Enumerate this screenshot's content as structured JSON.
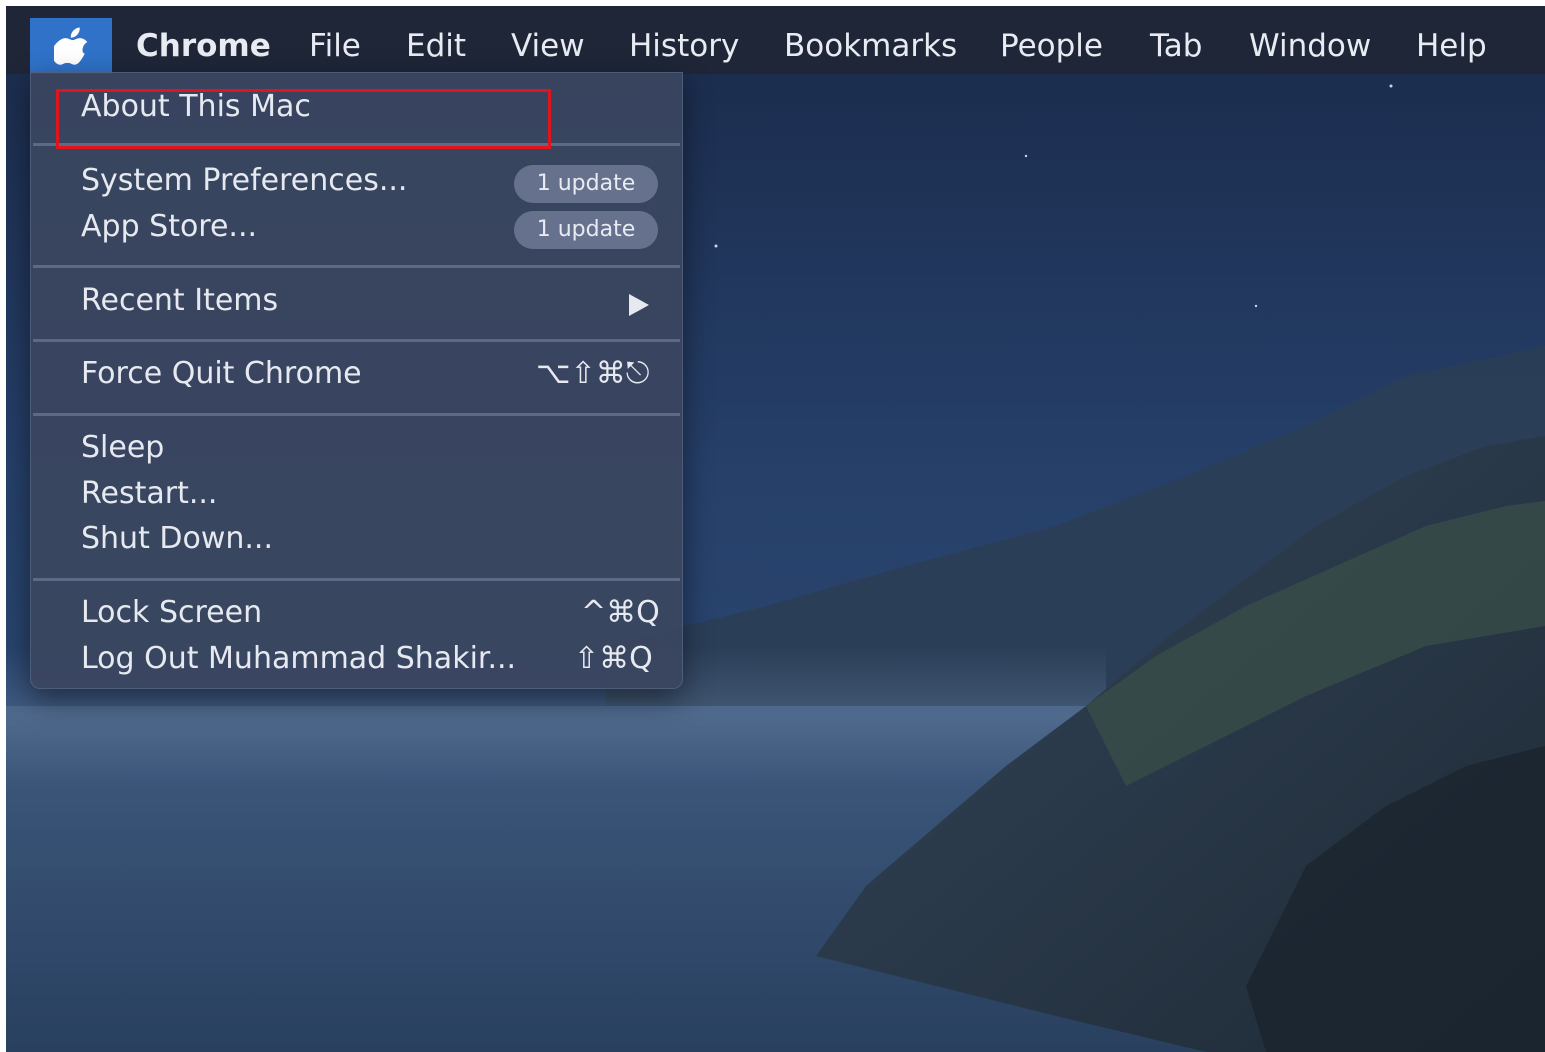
{
  "menubar": {
    "apple_icon": "apple-logo-icon",
    "items": [
      "Chrome",
      "File",
      "Edit",
      "View",
      "History",
      "Bookmarks",
      "People",
      "Tab",
      "Window",
      "Help"
    ]
  },
  "apple_menu": {
    "about": "About This Mac",
    "system_preferences": "System Preferences...",
    "system_preferences_badge": "1 update",
    "app_store": "App Store...",
    "app_store_badge": "1 update",
    "recent_items": "Recent Items",
    "recent_items_icon": "submenu-arrow-icon",
    "force_quit": "Force Quit Chrome",
    "force_quit_shortcut": "⌥⇧⌘⎋",
    "sleep": "Sleep",
    "restart": "Restart...",
    "shut_down": "Shut Down...",
    "lock_screen": "Lock Screen",
    "lock_screen_shortcut": "^⌘Q",
    "log_out": "Log Out Muhammad Shakir...",
    "log_out_shortcut": "⇧⌘Q"
  },
  "colors": {
    "highlight_box": "#e0151c",
    "apple_button": "#2f72c8"
  }
}
